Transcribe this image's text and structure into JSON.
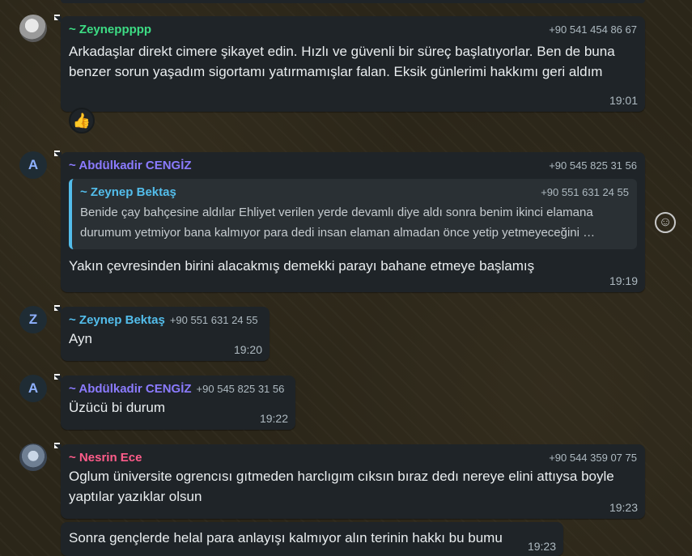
{
  "colors": {
    "bubble": "#1f2428",
    "zeynep_p": "#3ddc84",
    "abdulkadir": "#8b7bff",
    "zeynep_b": "#53bdeb",
    "nesrin": "#ff5c8a"
  },
  "messages": [
    {
      "sender": "~ Zeyneppppp",
      "phone": "+90 541 454 86 67",
      "text": "Arkadaşlar direkt cimere şikayet edin. Hızlı ve güvenli bir süreç başlatıyorlar.  Ben de buna benzer sorun yaşadım sigortamı yatırmamışlar falan. Eksik günlerimi hakkımı geri aldım",
      "time": "19:01",
      "reaction": "👍"
    },
    {
      "avatar_letter": "A",
      "sender": "~ Abdülkadir CENGİZ",
      "phone": "+90 545 825 31 56",
      "quote": {
        "sender": "~ Zeynep Bektaş",
        "phone": "+90 551 631 24 55",
        "text": "Benide çay bahçesine aldılar Ehliyet verilen yerde devamlı diye aldı sonra benim ikinci elamana durumum yetmiyor bana kalmıyor para dedi insan elaman almadan önce yetip yetmeyeceğini …"
      },
      "text": "Yakın çevresinden birini alacakmış demekki parayı bahane etmeye başlamış",
      "time": "19:19"
    },
    {
      "avatar_letter": "Z",
      "sender": "~ Zeynep Bektaş",
      "phone": "+90 551 631 24 55",
      "text": "Ayn",
      "time": "19:20"
    },
    {
      "avatar_letter": "A",
      "sender": "~ Abdülkadir CENGİZ",
      "phone": "+90 545 825 31 56",
      "text": "Üzücü bi durum",
      "time": "19:22"
    },
    {
      "sender": "~ Nesrin Ece",
      "phone": "+90 544 359 07 75",
      "text": "Oglum üniversite ogrencısı gıtmeden harclıgım cıksın bıraz dedı nereye elini attıysa boyle yaptılar yazıklar olsun",
      "time": "19:23"
    },
    {
      "text": "Sonra gençlerde helal para anlayışı kalmıyor alın terinin hakkı bu bumu",
      "time": "19:23"
    }
  ],
  "icons": {
    "emoji_button": "smiley-icon"
  }
}
